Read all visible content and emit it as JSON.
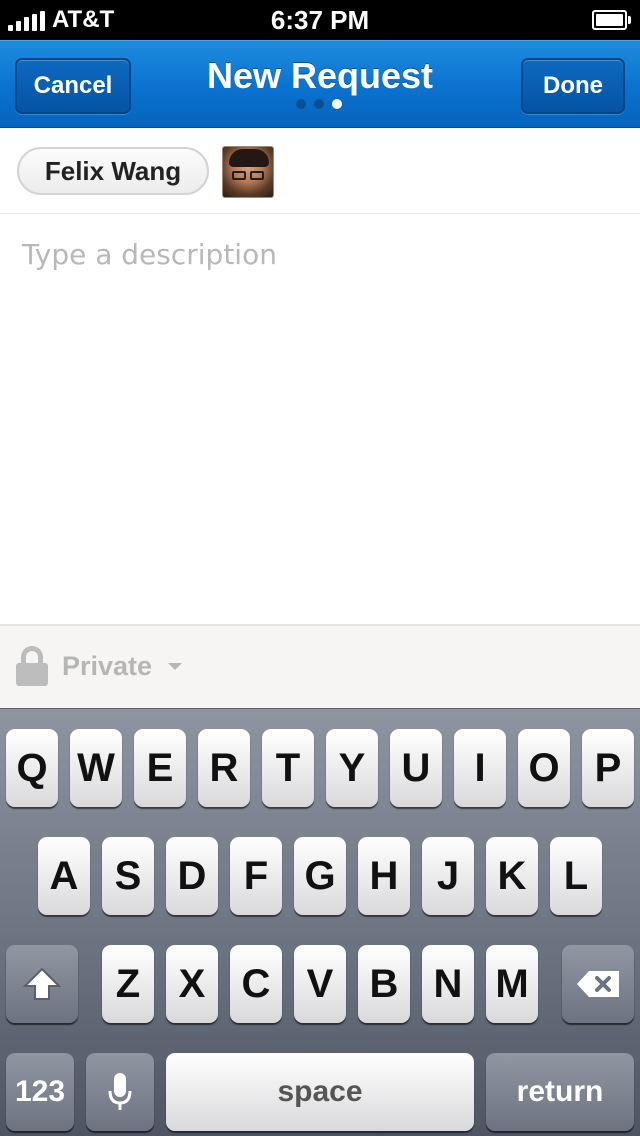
{
  "status_bar": {
    "carrier": "AT&T",
    "time": "6:37 PM"
  },
  "nav": {
    "cancel_label": "Cancel",
    "title": "New Request",
    "done_label": "Done",
    "page_count": 3,
    "active_page": 3
  },
  "recipient": {
    "name": "Felix Wang"
  },
  "description": {
    "placeholder": "Type a description",
    "value": ""
  },
  "privacy": {
    "label": "Private"
  },
  "keyboard": {
    "row1": [
      "Q",
      "W",
      "E",
      "R",
      "T",
      "Y",
      "U",
      "I",
      "O",
      "P"
    ],
    "row2": [
      "A",
      "S",
      "D",
      "F",
      "G",
      "H",
      "J",
      "K",
      "L"
    ],
    "row3": [
      "Z",
      "X",
      "C",
      "V",
      "B",
      "N",
      "M"
    ],
    "numbers_label": "123",
    "space_label": "space",
    "return_label": "return"
  },
  "colors": {
    "nav_blue": "#0a72cf",
    "nav_button": "#0553a4",
    "placeholder": "#b8b8b8"
  },
  "icons": [
    "signal-icon",
    "battery-icon",
    "lock-icon",
    "caret-down-icon",
    "shift-icon",
    "delete-icon",
    "microphone-icon"
  ]
}
